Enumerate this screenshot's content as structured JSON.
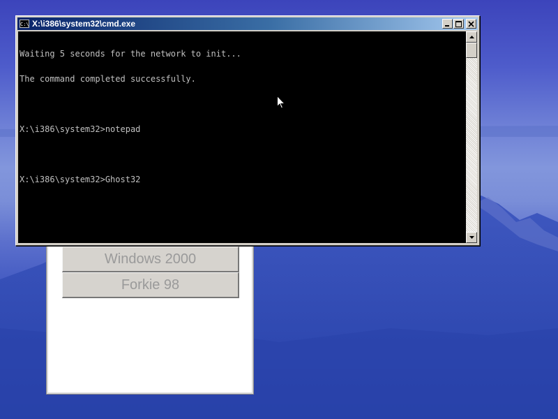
{
  "colors": {
    "titlebar_start": "#0a246a",
    "titlebar_end": "#a6caf0",
    "console_bg": "#000000",
    "console_text": "#c0c0c0",
    "window_face": "#d4d0c8",
    "boot_button_text": "#9a9a9a"
  },
  "desktop": {
    "wallpaper": "mountain-at-dusk"
  },
  "boot_menu": {
    "buttons": [
      {
        "label": "Windows 2000"
      },
      {
        "label": "Forkie 98"
      }
    ]
  },
  "cmd_window": {
    "title": "X:\\i386\\system32\\cmd.exe",
    "icon": "console-icon",
    "icon_text": "C:\\",
    "controls": [
      "minimize-icon",
      "maximize-icon",
      "close-icon"
    ],
    "console_lines": [
      "Waiting 5 seconds for the network to init...",
      "The command completed successfully.",
      "",
      "X:\\i386\\system32>notepad",
      "",
      "X:\\i386\\system32>Ghost32"
    ],
    "scrollbar": {
      "position": 0
    }
  },
  "pointer": {
    "icon": "arrow-cursor-icon"
  }
}
